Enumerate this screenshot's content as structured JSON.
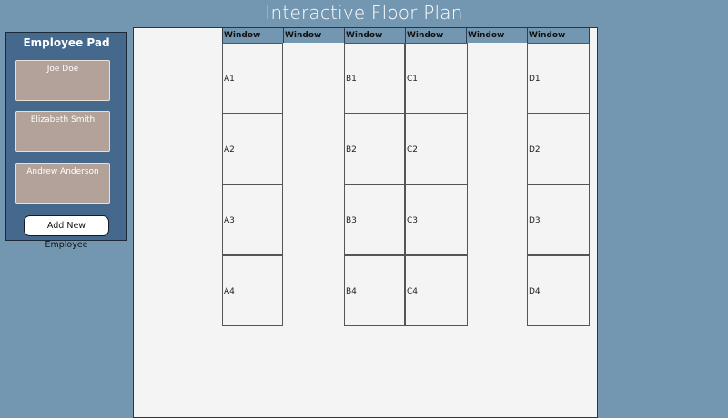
{
  "app": {
    "title": "Interactive Floor Plan"
  },
  "employee_pad": {
    "title": "Employee Pad",
    "employees": [
      {
        "name": "Joe Doe"
      },
      {
        "name": "Elizabeth Smith"
      },
      {
        "name": "Andrew Anderson"
      }
    ],
    "add_button_label": "Add New Employee"
  },
  "floor_plan": {
    "window_label": "Window",
    "desks": {
      "A1": "A1",
      "A2": "A2",
      "A3": "A3",
      "A4": "A4",
      "B1": "B1",
      "B2": "B2",
      "B3": "B3",
      "B4": "B4",
      "C1": "C1",
      "C2": "C2",
      "C3": "C3",
      "C4": "C4",
      "D1": "D1",
      "D2": "D2",
      "D3": "D3",
      "D4": "D4"
    }
  },
  "colors": {
    "background": "#7497b1",
    "pad_background": "#44698c",
    "employee_card": "#b3a299",
    "floor_background": "#f4f4f4"
  }
}
